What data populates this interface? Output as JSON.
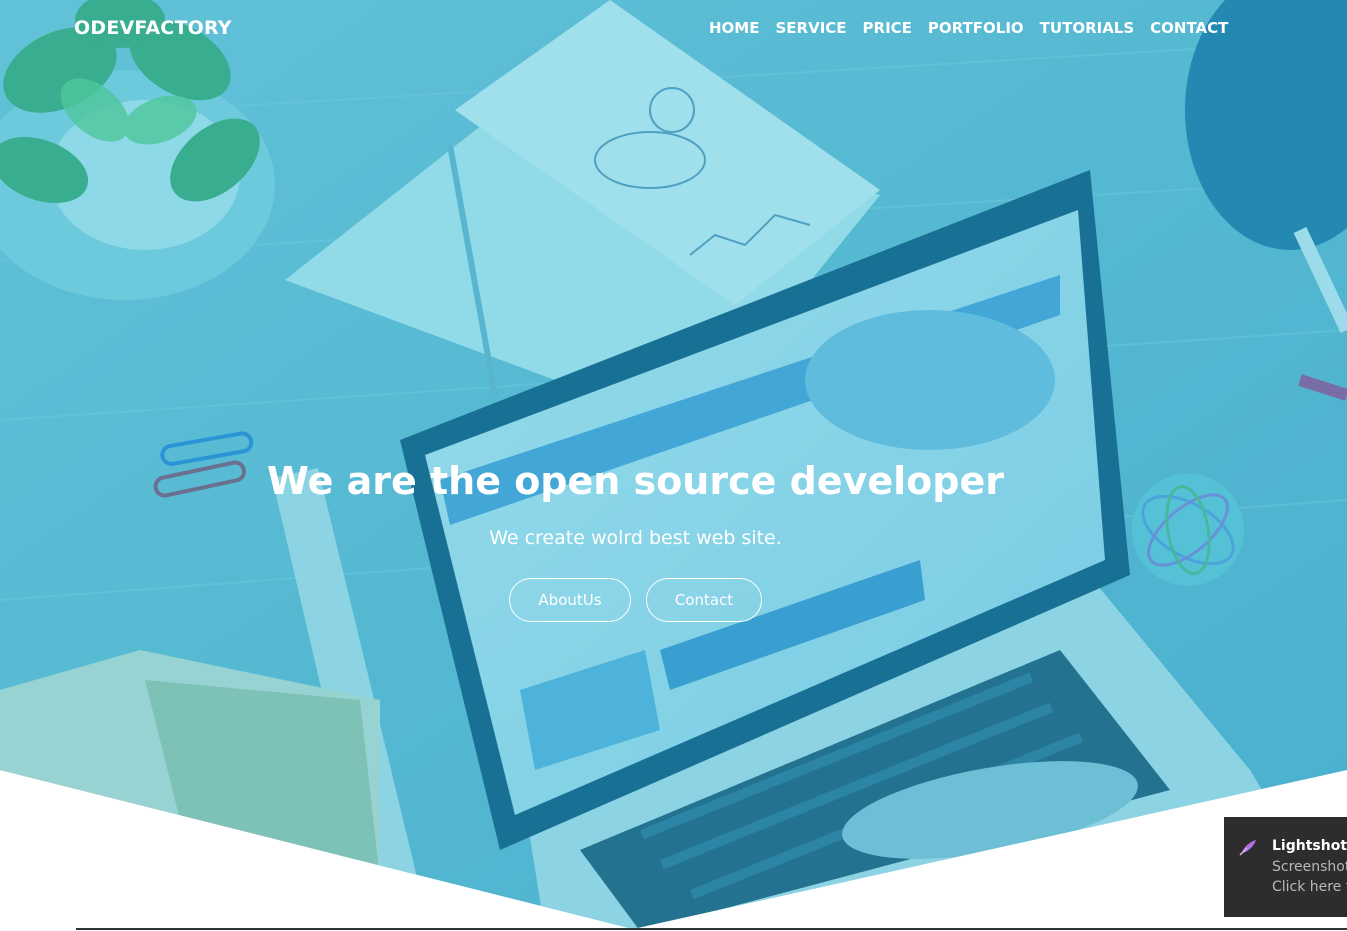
{
  "brand": {
    "name": "ODEVFACTORY"
  },
  "nav": {
    "items": [
      "HOME",
      "SERVICE",
      "PRICE",
      "PORTFOLIO",
      "TUTORIALS",
      "CONTACT"
    ]
  },
  "hero": {
    "title": "We are the open source developer",
    "subtitle": "We create wolrd best web site.",
    "buttons": {
      "about": "AboutUs",
      "contact": "Contact"
    },
    "overlay_color": "#2fb6d6"
  },
  "notification": {
    "title": "Lightshot",
    "line1": "Screenshot",
    "line2": "Click here t",
    "icon": "feather-icon"
  },
  "colors": {
    "overlay": "#2fb6d6",
    "text": "#ffffff",
    "toast_bg": "#2d2d2d"
  }
}
